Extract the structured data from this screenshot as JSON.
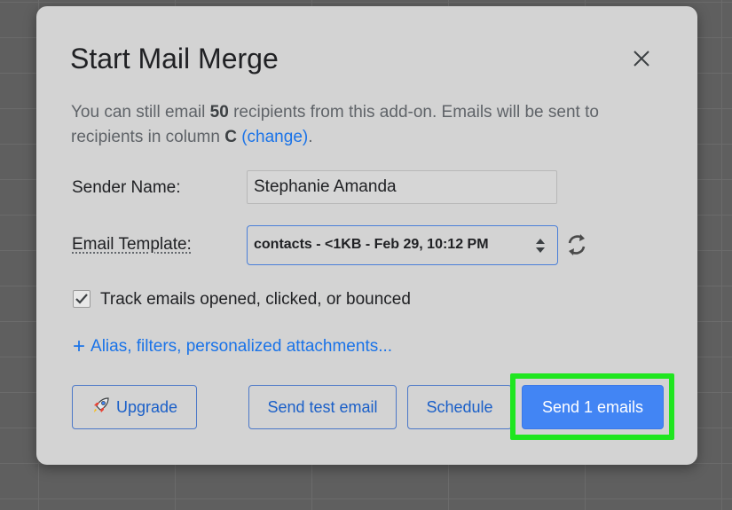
{
  "dialog": {
    "title": "Start Mail Merge",
    "info": {
      "part1": "You can still email ",
      "count": "50",
      "part2": " recipients from this add-on. Emails will be sent to recipients in column ",
      "column": "C",
      "change_link": "(change)",
      "end": "."
    },
    "sender_label": "Sender Name:",
    "sender_value": "Stephanie Amanda",
    "template_label": "Email Template:",
    "template_value": "contacts - <1KB - Feb 29, 10:12 PM",
    "track_label": "Track emails opened, clicked, or bounced",
    "track_checked": true,
    "advanced_link": "Alias, filters, personalized attachments...",
    "buttons": {
      "upgrade": "Upgrade",
      "test": "Send test email",
      "schedule": "Schedule",
      "send": "Send 1 emails"
    }
  },
  "icons": {
    "close": "close-icon",
    "select_arrows": "select-arrows-icon",
    "refresh": "refresh-icon",
    "check": "checkmark-icon",
    "plus": "plus-icon",
    "rocket": "rocket-icon"
  },
  "colors": {
    "accent": "#1a73e8",
    "primary_button": "#4285f4",
    "highlight": "#1fe61f",
    "dialog_bg": "#d3d3d3"
  }
}
